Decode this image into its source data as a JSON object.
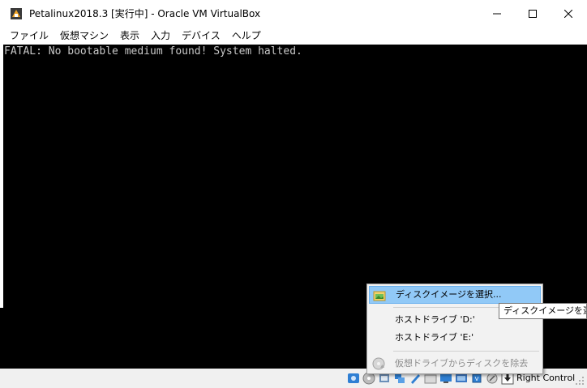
{
  "window": {
    "title": "Petalinux2018.3 [実行中] - Oracle VM VirtualBox"
  },
  "menubar": {
    "items": [
      {
        "label": "ファイル"
      },
      {
        "label": "仮想マシン"
      },
      {
        "label": "表示"
      },
      {
        "label": "入力"
      },
      {
        "label": "デバイス"
      },
      {
        "label": "ヘルプ"
      }
    ]
  },
  "console": {
    "text": "FATAL: No bootable medium found! System halted."
  },
  "context_menu": {
    "items": [
      {
        "label": "ディスクイメージを選択...",
        "icon": "folder-image-icon",
        "highlighted": true
      },
      {
        "label": "ホストドライブ 'D:'"
      },
      {
        "label": "ホストドライブ 'E:'"
      },
      {
        "label": "仮想ドライブからディスクを除去",
        "icon": "eject-disc-icon",
        "disabled": true
      }
    ]
  },
  "tooltip": {
    "text": "ディスクイメージを選択"
  },
  "statusbar": {
    "host_key": "Right Control",
    "icons": [
      "hard-disk-icon",
      "optical-drive-icon",
      "audio-icon",
      "network-icon",
      "usb-icon",
      "shared-folders-icon",
      "display-icon",
      "video-capture-icon",
      "cpu-icon",
      "mouse-integration-icon",
      "host-key-arrow-icon"
    ]
  },
  "colors": {
    "highlight": "#91c9f7",
    "console_text": "#c8c8c8",
    "vm_background": "#000000"
  }
}
